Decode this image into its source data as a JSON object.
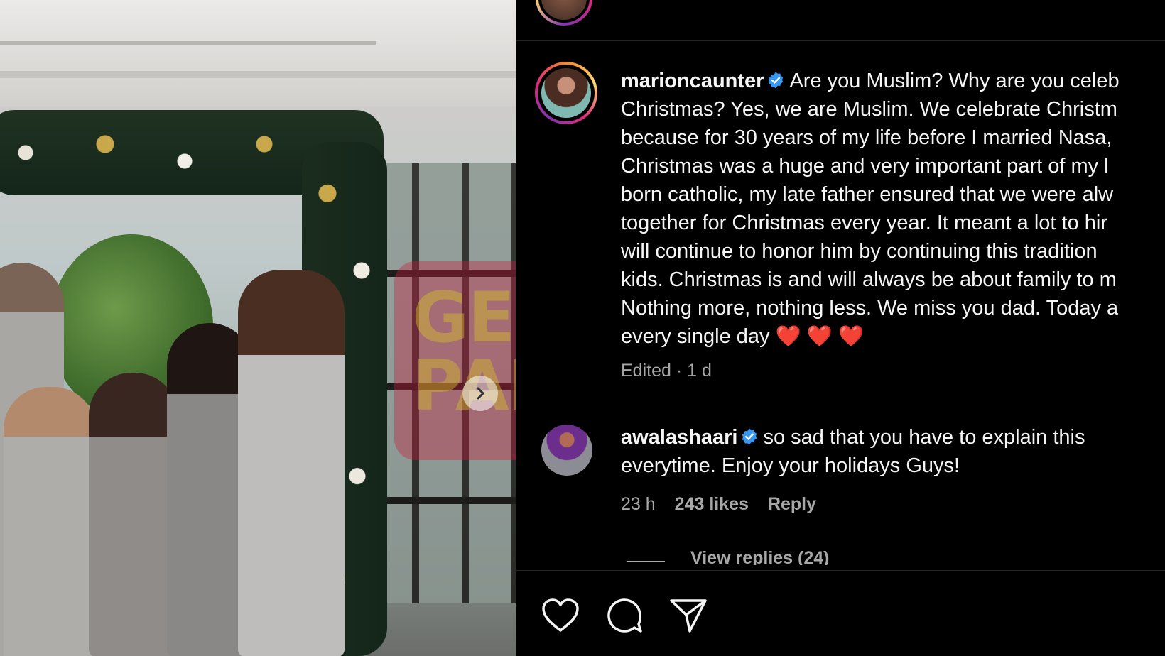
{
  "post": {
    "image_alt": "family photo in front of a Christmas garland",
    "next_icon": "chevron-right-icon",
    "watermark": {
      "line1": "GEM",
      "line2": "PAK"
    }
  },
  "caption": {
    "username": "marioncaunter",
    "verified": true,
    "lines": [
      "Are you Muslim? Why are you celeb",
      "Christmas? Yes, we are Muslim. We celebrate Christm",
      "because for 30 years of my life before I married Nasa,",
      "Christmas was a huge and very important part of my l",
      "born catholic, my late father ensured that we were alw",
      "together for Christmas every year. It meant a lot to hir",
      "will continue to honor him by continuing this tradition",
      "kids. Christmas is and will always be about family to m",
      "Nothing more, nothing less. We miss you dad. Today a",
      "every single day ❤️ ❤️ ❤️"
    ],
    "meta": "Edited · 1 d"
  },
  "comment": {
    "username": "awalashaari",
    "verified": true,
    "text_line1": "so sad that you have to explain this",
    "text_line2": "everytime. Enjoy your holidays Guys!",
    "time": "23 h",
    "likes": "243 likes",
    "reply_label": "Reply",
    "view_replies": "View replies (24)"
  },
  "actions": [
    "heart-icon",
    "comment-icon",
    "share-icon"
  ],
  "colors": {
    "background": "#000000",
    "text": "#f5f5f5",
    "muted": "#a8a8a8",
    "verified": "#3897f0"
  }
}
